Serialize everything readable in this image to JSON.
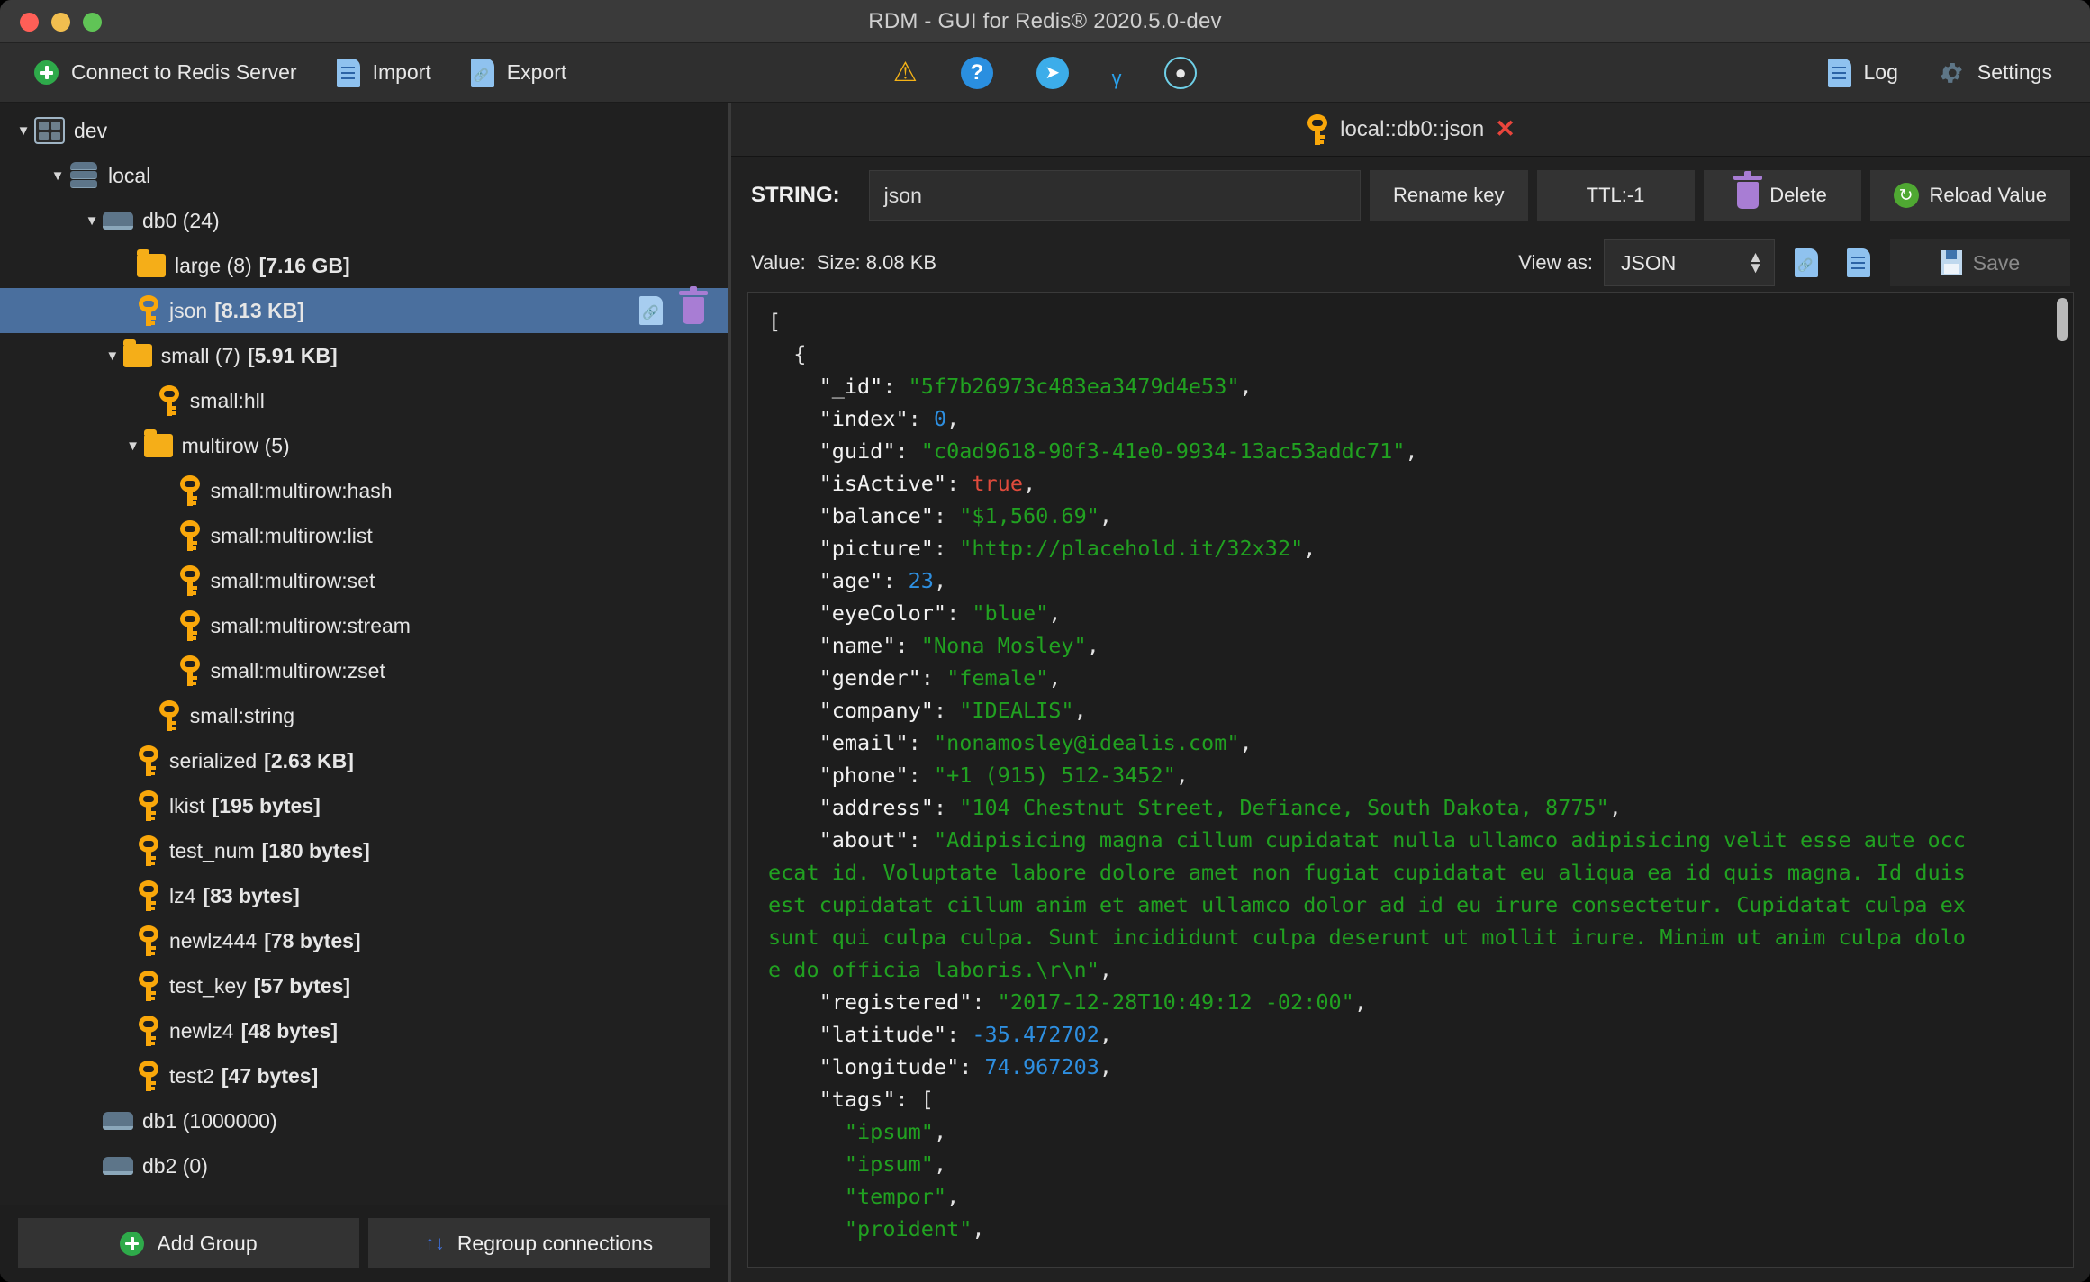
{
  "window": {
    "title": "RDM - GUI for Redis® 2020.5.0-dev",
    "accent": "#4a6f9e",
    "key_icon_color": "#f9a70a"
  },
  "toolbar": {
    "connect_label": "Connect to Redis Server",
    "import_label": "Import",
    "export_label": "Export",
    "center_icons": [
      {
        "name": "warning-icon",
        "glyph": "⚠"
      },
      {
        "name": "help-icon",
        "glyph": "?"
      },
      {
        "name": "telegram-icon",
        "glyph": "➤"
      },
      {
        "name": "twitter-icon",
        "glyph": "ᵧ"
      },
      {
        "name": "github-icon",
        "glyph": "●"
      }
    ],
    "log_label": "Log",
    "settings_label": "Settings"
  },
  "sidebar": {
    "items": [
      {
        "indent": 0,
        "arrow": "▼",
        "icon": "grid",
        "label": "dev",
        "size": "",
        "selected": false
      },
      {
        "indent": 1,
        "arrow": "▼",
        "icon": "server",
        "label": "local",
        "size": "",
        "selected": false
      },
      {
        "indent": 2,
        "arrow": "▼",
        "icon": "db",
        "label": "db0  (24)",
        "size": "",
        "selected": false
      },
      {
        "indent": 3,
        "arrow": "",
        "icon": "folder",
        "label": "large (8)",
        "size": "[7.16 GB]",
        "selected": false
      },
      {
        "indent": 3,
        "arrow": "",
        "icon": "key",
        "label": "json",
        "size": "[8.13 KB]",
        "selected": true
      },
      {
        "indent": 2.6,
        "arrow": "▼",
        "icon": "folder",
        "label": "small (7)",
        "size": "[5.91 KB]",
        "selected": false
      },
      {
        "indent": 3.6,
        "arrow": "",
        "icon": "key",
        "label": "small:hll",
        "size": "",
        "selected": false
      },
      {
        "indent": 3.2,
        "arrow": "▼",
        "icon": "folder",
        "label": "multirow (5)",
        "size": "",
        "selected": false
      },
      {
        "indent": 4.2,
        "arrow": "",
        "icon": "key",
        "label": "small:multirow:hash",
        "size": "",
        "selected": false
      },
      {
        "indent": 4.2,
        "arrow": "",
        "icon": "key",
        "label": "small:multirow:list",
        "size": "",
        "selected": false
      },
      {
        "indent": 4.2,
        "arrow": "",
        "icon": "key",
        "label": "small:multirow:set",
        "size": "",
        "selected": false
      },
      {
        "indent": 4.2,
        "arrow": "",
        "icon": "key",
        "label": "small:multirow:stream",
        "size": "",
        "selected": false
      },
      {
        "indent": 4.2,
        "arrow": "",
        "icon": "key",
        "label": "small:multirow:zset",
        "size": "",
        "selected": false
      },
      {
        "indent": 3.6,
        "arrow": "",
        "icon": "key",
        "label": "small:string",
        "size": "",
        "selected": false
      },
      {
        "indent": 3,
        "arrow": "",
        "icon": "key",
        "label": "serialized",
        "size": "[2.63 KB]",
        "selected": false
      },
      {
        "indent": 3,
        "arrow": "",
        "icon": "key",
        "label": "lkist",
        "size": "[195 bytes]",
        "selected": false
      },
      {
        "indent": 3,
        "arrow": "",
        "icon": "key",
        "label": "test_num",
        "size": "[180 bytes]",
        "selected": false
      },
      {
        "indent": 3,
        "arrow": "",
        "icon": "key",
        "label": "lz4",
        "size": "[83 bytes]",
        "selected": false
      },
      {
        "indent": 3,
        "arrow": "",
        "icon": "key",
        "label": "newlz444",
        "size": "[78 bytes]",
        "selected": false
      },
      {
        "indent": 3,
        "arrow": "",
        "icon": "key",
        "label": "test_key",
        "size": "[57 bytes]",
        "selected": false
      },
      {
        "indent": 3,
        "arrow": "",
        "icon": "key",
        "label": "newlz4",
        "size": "[48 bytes]",
        "selected": false
      },
      {
        "indent": 3,
        "arrow": "",
        "icon": "key",
        "label": "test2",
        "size": "[47 bytes]",
        "selected": false
      },
      {
        "indent": 2,
        "arrow": "",
        "icon": "db",
        "label": "db1  (1000000)",
        "size": "",
        "selected": false
      },
      {
        "indent": 2,
        "arrow": "",
        "icon": "db",
        "label": "db2  (0)",
        "size": "",
        "selected": false
      }
    ],
    "footer": {
      "add_group_label": "Add Group",
      "regroup_label": "Regroup connections",
      "regroup_icon": "↑↓"
    }
  },
  "main": {
    "tab": {
      "label": "local::db0::json",
      "close": "✕"
    },
    "keybar": {
      "type_label": "STRING:",
      "key_value": "json",
      "rename_label": "Rename key",
      "ttl_label": "TTL:-1",
      "delete_label": "Delete",
      "reload_label": "Reload Value",
      "reload_glyph": "↻"
    },
    "valuebar": {
      "value_label": "Value:",
      "size_label": "Size: 8.08 KB",
      "view_as_label": "View as:",
      "view_as_value": "JSON",
      "save_label": "Save"
    },
    "value_lines": [
      [
        [
          "p",
          "["
        ]
      ],
      [
        [
          "p",
          "  {"
        ]
      ],
      [
        [
          "p",
          "    "
        ],
        [
          "k",
          "\"_id\""
        ],
        [
          "p",
          ": "
        ],
        [
          "s",
          "\"5f7b26973c483ea3479d4e53\""
        ],
        [
          "p",
          ","
        ]
      ],
      [
        [
          "p",
          "    "
        ],
        [
          "k",
          "\"index\""
        ],
        [
          "p",
          ": "
        ],
        [
          "n",
          "0"
        ],
        [
          "p",
          ","
        ]
      ],
      [
        [
          "p",
          "    "
        ],
        [
          "k",
          "\"guid\""
        ],
        [
          "p",
          ": "
        ],
        [
          "s",
          "\"c0ad9618-90f3-41e0-9934-13ac53addc71\""
        ],
        [
          "p",
          ","
        ]
      ],
      [
        [
          "p",
          "    "
        ],
        [
          "k",
          "\"isActive\""
        ],
        [
          "p",
          ": "
        ],
        [
          "b",
          "true"
        ],
        [
          "p",
          ","
        ]
      ],
      [
        [
          "p",
          "    "
        ],
        [
          "k",
          "\"balance\""
        ],
        [
          "p",
          ": "
        ],
        [
          "s",
          "\"$1,560.69\""
        ],
        [
          "p",
          ","
        ]
      ],
      [
        [
          "p",
          "    "
        ],
        [
          "k",
          "\"picture\""
        ],
        [
          "p",
          ": "
        ],
        [
          "s",
          "\"http://placehold.it/32x32\""
        ],
        [
          "p",
          ","
        ]
      ],
      [
        [
          "p",
          "    "
        ],
        [
          "k",
          "\"age\""
        ],
        [
          "p",
          ": "
        ],
        [
          "n",
          "23"
        ],
        [
          "p",
          ","
        ]
      ],
      [
        [
          "p",
          "    "
        ],
        [
          "k",
          "\"eyeColor\""
        ],
        [
          "p",
          ": "
        ],
        [
          "s",
          "\"blue\""
        ],
        [
          "p",
          ","
        ]
      ],
      [
        [
          "p",
          "    "
        ],
        [
          "k",
          "\"name\""
        ],
        [
          "p",
          ": "
        ],
        [
          "s",
          "\"Nona Mosley\""
        ],
        [
          "p",
          ","
        ]
      ],
      [
        [
          "p",
          "    "
        ],
        [
          "k",
          "\"gender\""
        ],
        [
          "p",
          ": "
        ],
        [
          "s",
          "\"female\""
        ],
        [
          "p",
          ","
        ]
      ],
      [
        [
          "p",
          "    "
        ],
        [
          "k",
          "\"company\""
        ],
        [
          "p",
          ": "
        ],
        [
          "s",
          "\"IDEALIS\""
        ],
        [
          "p",
          ","
        ]
      ],
      [
        [
          "p",
          "    "
        ],
        [
          "k",
          "\"email\""
        ],
        [
          "p",
          ": "
        ],
        [
          "s",
          "\"nonamosley@idealis.com\""
        ],
        [
          "p",
          ","
        ]
      ],
      [
        [
          "p",
          "    "
        ],
        [
          "k",
          "\"phone\""
        ],
        [
          "p",
          ": "
        ],
        [
          "s",
          "\"+1 (915) 512-3452\""
        ],
        [
          "p",
          ","
        ]
      ],
      [
        [
          "p",
          "    "
        ],
        [
          "k",
          "\"address\""
        ],
        [
          "p",
          ": "
        ],
        [
          "s",
          "\"104 Chestnut Street, Defiance, South Dakota, 8775\""
        ],
        [
          "p",
          ","
        ]
      ],
      [
        [
          "p",
          "    "
        ],
        [
          "k",
          "\"about\""
        ],
        [
          "p",
          ": "
        ],
        [
          "s",
          "\"Adipisicing magna cillum cupidatat nulla ullamco adipisicing velit esse aute occ"
        ]
      ],
      [
        [
          "s",
          "ecat id. Voluptate labore dolore amet non fugiat cupidatat eu aliqua ea id quis magna. Id duis"
        ]
      ],
      [
        [
          "s",
          "est cupidatat cillum anim et amet ullamco dolor ad id eu irure consectetur. Cupidatat culpa ex"
        ]
      ],
      [
        [
          "s",
          "sunt qui culpa culpa. Sunt incididunt culpa deserunt ut mollit irure. Minim ut anim culpa dolo"
        ]
      ],
      [
        [
          "s",
          "e do officia laboris.\\r\\n\""
        ],
        [
          "p",
          ","
        ]
      ],
      [
        [
          "p",
          "    "
        ],
        [
          "k",
          "\"registered\""
        ],
        [
          "p",
          ": "
        ],
        [
          "s",
          "\"2017-12-28T10:49:12 -02:00\""
        ],
        [
          "p",
          ","
        ]
      ],
      [
        [
          "p",
          "    "
        ],
        [
          "k",
          "\"latitude\""
        ],
        [
          "p",
          ": "
        ],
        [
          "n",
          "-35.472702"
        ],
        [
          "p",
          ","
        ]
      ],
      [
        [
          "p",
          "    "
        ],
        [
          "k",
          "\"longitude\""
        ],
        [
          "p",
          ": "
        ],
        [
          "n",
          "74.967203"
        ],
        [
          "p",
          ","
        ]
      ],
      [
        [
          "p",
          "    "
        ],
        [
          "k",
          "\"tags\""
        ],
        [
          "p",
          ": ["
        ]
      ],
      [
        [
          "p",
          "      "
        ],
        [
          "s",
          "\"ipsum\""
        ],
        [
          "p",
          ","
        ]
      ],
      [
        [
          "p",
          "      "
        ],
        [
          "s",
          "\"ipsum\""
        ],
        [
          "p",
          ","
        ]
      ],
      [
        [
          "p",
          "      "
        ],
        [
          "s",
          "\"tempor\""
        ],
        [
          "p",
          ","
        ]
      ],
      [
        [
          "p",
          "      "
        ],
        [
          "s",
          "\"proident\""
        ],
        [
          "p",
          ","
        ]
      ]
    ]
  }
}
